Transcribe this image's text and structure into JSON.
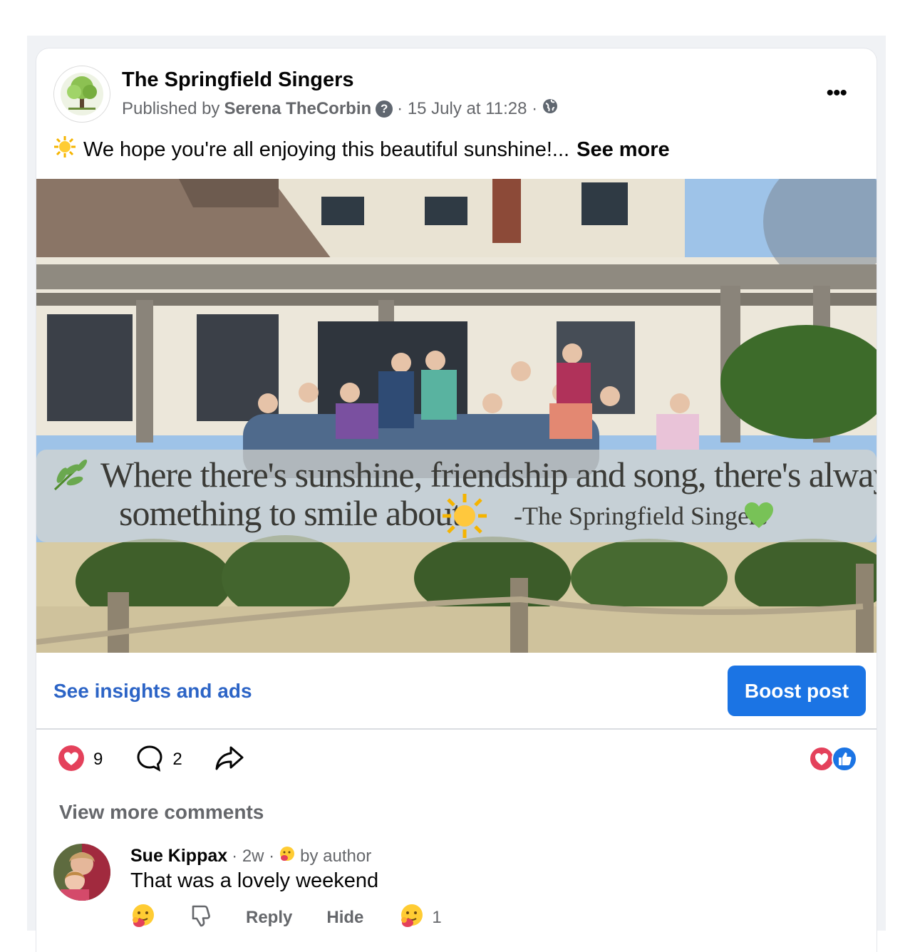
{
  "post": {
    "page_name": "The Springfield Singers",
    "published_by_prefix": "Published by",
    "author": "Serena TheCorbin",
    "help_mark": "?",
    "date": "· 15 July at 11:28 ·",
    "audience_icon": "globe-icon",
    "more_label": "•••",
    "text": "We hope you're all enjoying this beautiful sunshine!...",
    "see_more": "See more"
  },
  "photo": {
    "quote_line1": "Where there's sunshine, friendship and song, there's always",
    "quote_line2": "something to smile about.",
    "signature": "-The Springfield Singers"
  },
  "footer": {
    "insights_label": "See insights and ads",
    "boost_label": "Boost post"
  },
  "engagement": {
    "reactions_count": "9",
    "comments_count": "2",
    "colors": {
      "love": "#e4415b",
      "like": "#1b74e4"
    }
  },
  "comments": {
    "view_more": "View more comments",
    "items": [
      {
        "name": "Sue Kippax",
        "time": "· 2w ·",
        "badge": "by author",
        "text": "That was a lovely weekend",
        "reply": "Reply",
        "hide": "Hide",
        "reaction_count": "1"
      }
    ]
  }
}
